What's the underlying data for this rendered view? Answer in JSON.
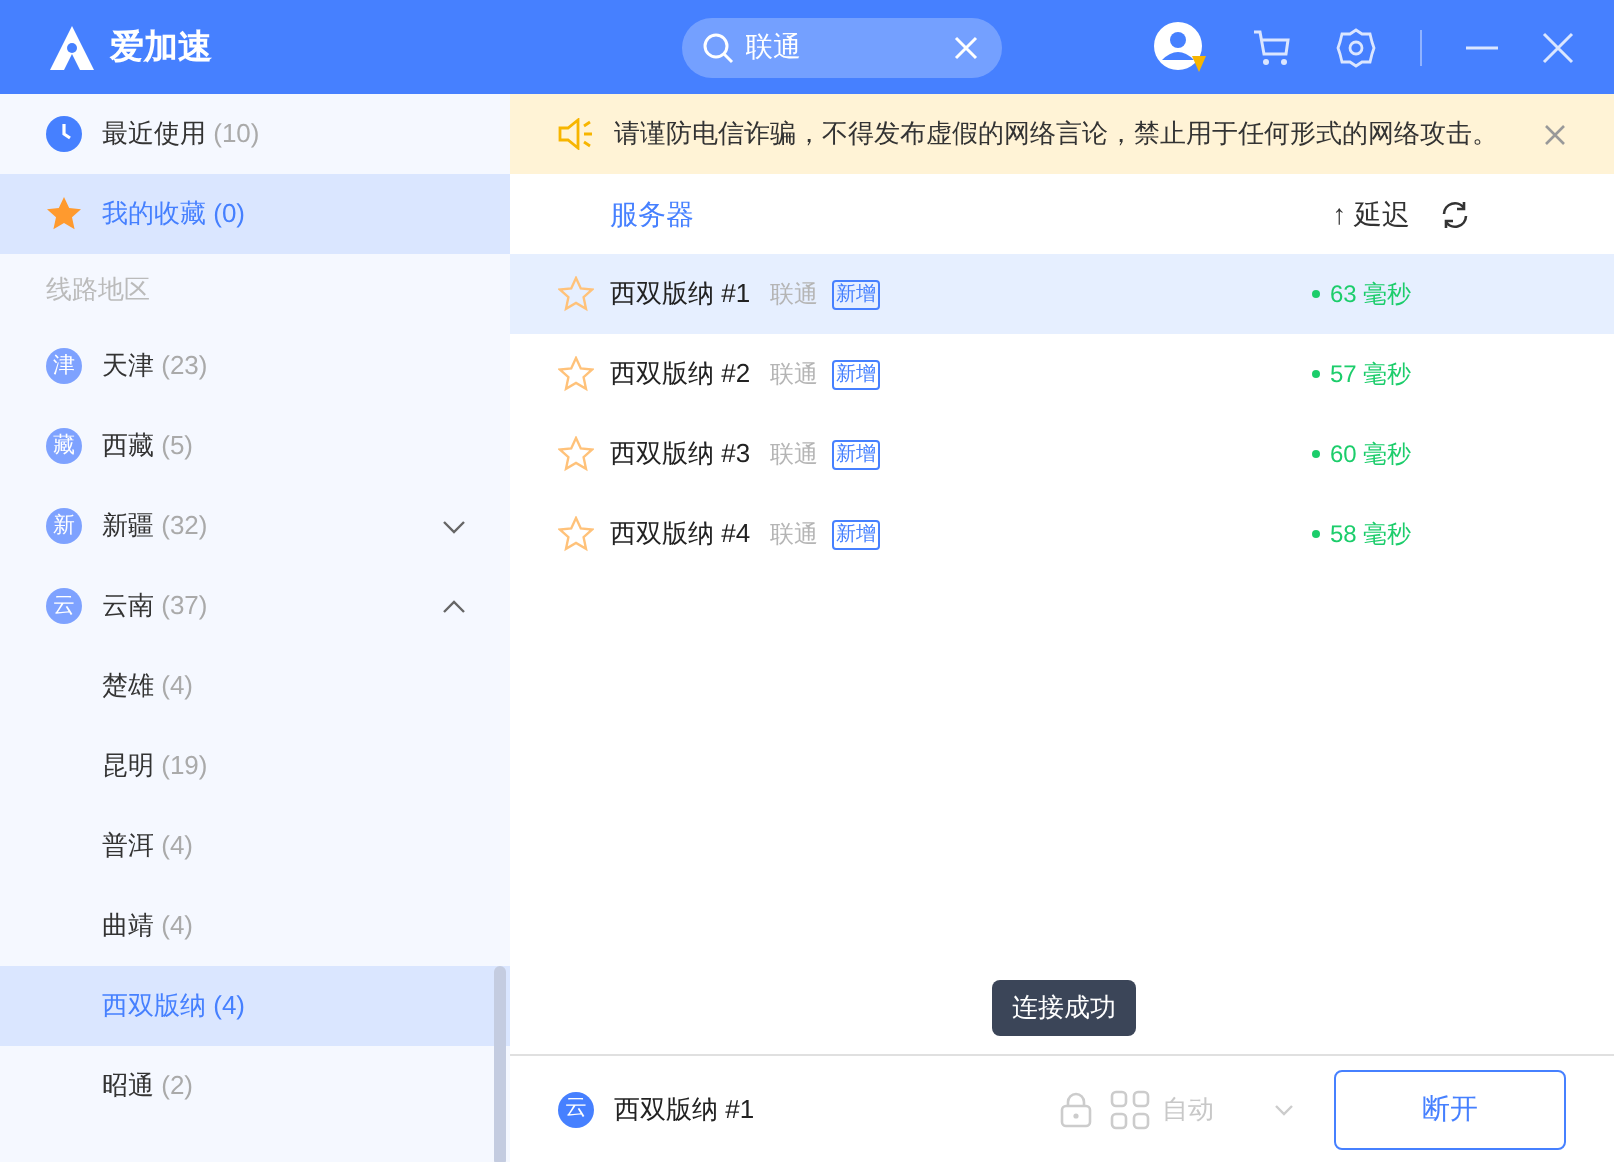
{
  "app": {
    "name": "爱加速"
  },
  "search": {
    "value": "联通"
  },
  "sidebar": {
    "items": [
      {
        "kind": "recent",
        "label": "最近使用",
        "count": "(10)",
        "selected": false
      },
      {
        "kind": "favorites",
        "label": "我的收藏",
        "count": "(0)",
        "selected": true
      },
      {
        "kind": "section",
        "label": "线路地区"
      },
      {
        "kind": "region",
        "badge": "津",
        "label": "天津",
        "count": "(23)",
        "selected": false
      },
      {
        "kind": "region",
        "badge": "藏",
        "label": "西藏",
        "count": "(5)",
        "selected": false
      },
      {
        "kind": "region",
        "badge": "新",
        "label": "新疆",
        "count": "(32)",
        "selected": false,
        "expanded": false
      },
      {
        "kind": "region",
        "badge": "云",
        "label": "云南",
        "count": "(37)",
        "selected": false,
        "expanded": true,
        "children": [
          {
            "label": "楚雄",
            "count": "(4)",
            "selected": false
          },
          {
            "label": "昆明",
            "count": "(19)",
            "selected": false
          },
          {
            "label": "普洱",
            "count": "(4)",
            "selected": false
          },
          {
            "label": "曲靖",
            "count": "(4)",
            "selected": false
          },
          {
            "label": "西双版纳",
            "count": "(4)",
            "selected": true
          },
          {
            "label": "昭通",
            "count": "(2)",
            "selected": false
          }
        ]
      }
    ]
  },
  "notice": {
    "text": "请谨防电信诈骗，不得发布虚假的网络言论，禁止用于任何形式的网络攻击。"
  },
  "table": {
    "columns": [
      "服务器",
      "延迟"
    ],
    "sort_arrow": "↑",
    "rows": [
      {
        "name": "西双版纳 #1",
        "isp": "联通",
        "tag": "新增",
        "latency": "63 毫秒",
        "starred": false,
        "selected": true
      },
      {
        "name": "西双版纳 #2",
        "isp": "联通",
        "tag": "新增",
        "latency": "57 毫秒",
        "starred": false,
        "selected": false
      },
      {
        "name": "西双版纳 #3",
        "isp": "联通",
        "tag": "新增",
        "latency": "60 毫秒",
        "starred": false,
        "selected": false
      },
      {
        "name": "西双版纳 #4",
        "isp": "联通",
        "tag": "新增",
        "latency": "58 毫秒",
        "starred": false,
        "selected": false
      }
    ]
  },
  "tooltip": {
    "text": "连接成功"
  },
  "footer": {
    "badge": "云",
    "server": "西双版纳 #1",
    "mode": "自动",
    "button": "断开"
  }
}
